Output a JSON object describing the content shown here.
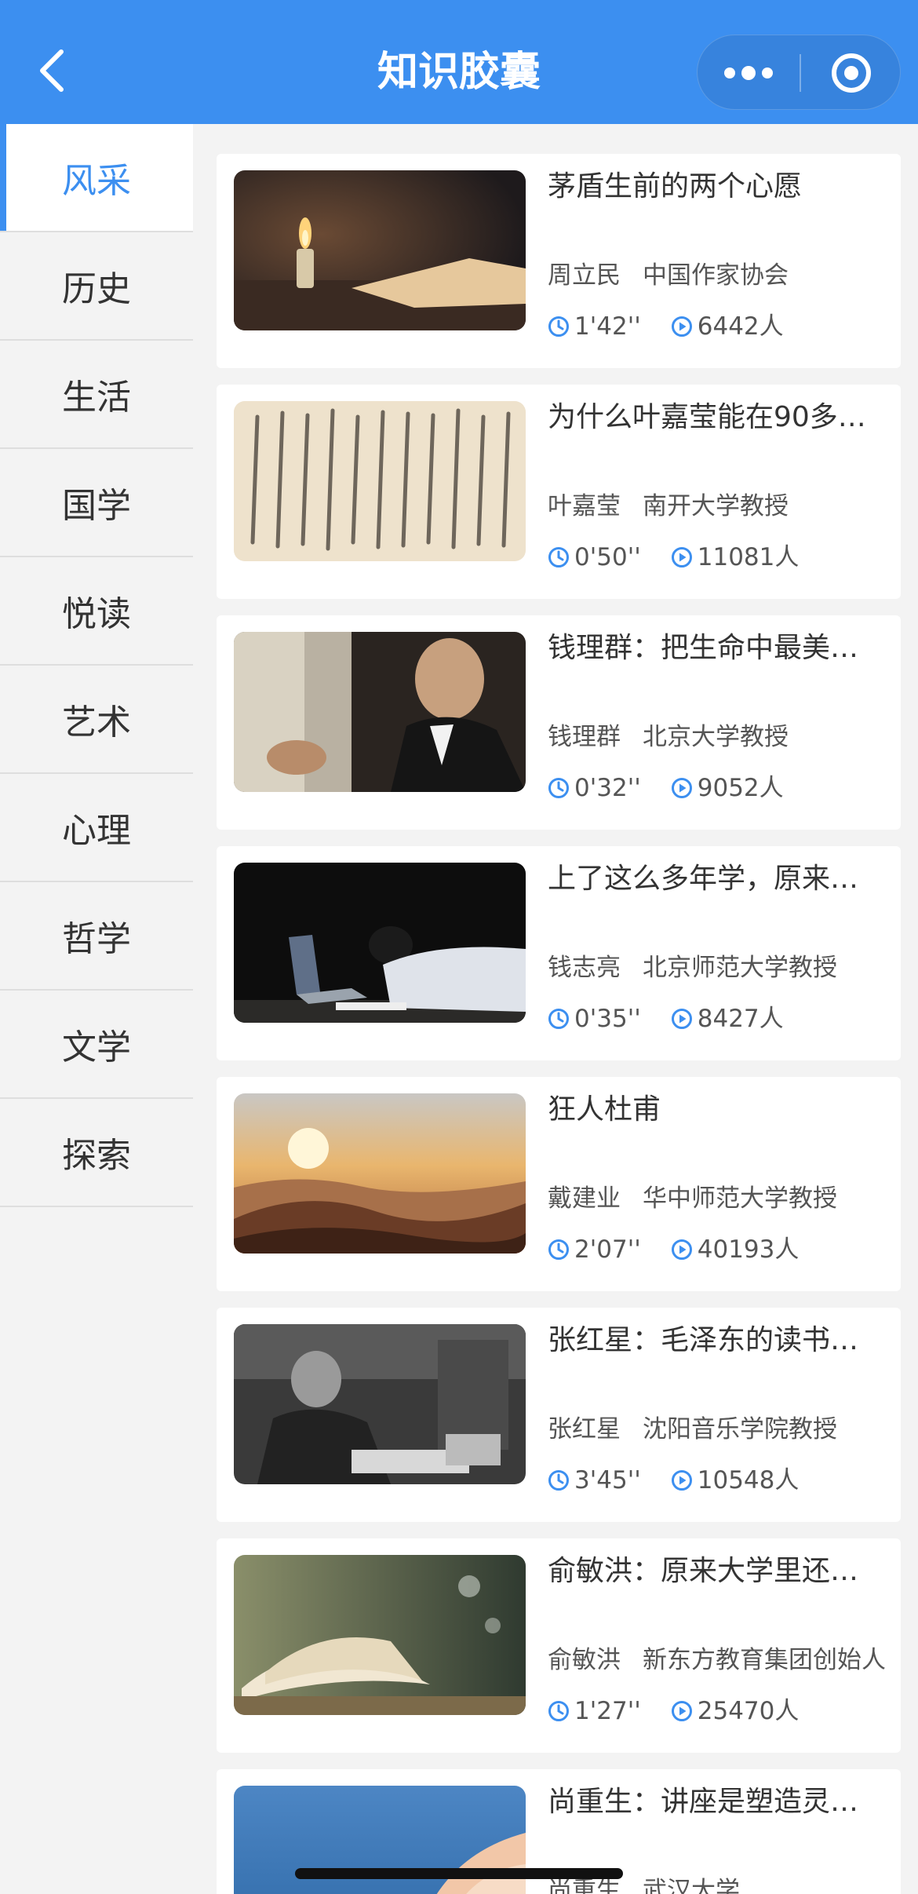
{
  "header": {
    "title": "知识胶囊",
    "back_icon": "chevron-left-icon",
    "more_icon": "more-dots-icon",
    "close_icon": "target-close-icon",
    "bg_color": "#3c8ff0"
  },
  "sidebar": {
    "active_index": 0,
    "items": [
      {
        "label": "风采"
      },
      {
        "label": "历史"
      },
      {
        "label": "生活"
      },
      {
        "label": "国学"
      },
      {
        "label": "悦读"
      },
      {
        "label": "艺术"
      },
      {
        "label": "心理"
      },
      {
        "label": "哲学"
      },
      {
        "label": "文学"
      },
      {
        "label": "探索"
      }
    ]
  },
  "cards": [
    {
      "title": "茅盾生前的两个心愿",
      "author": "周立民",
      "org": "中国作家协会",
      "duration": "1'42''",
      "views": "6442人",
      "thumb": "candle-image"
    },
    {
      "title": "为什么叶嘉莹能在90多…",
      "author": "叶嘉莹",
      "org": "南开大学教授",
      "duration": "0'50''",
      "views": "11081人",
      "thumb": "calligraphy-image"
    },
    {
      "title": "钱理群：把生命中最美…",
      "author": "钱理群",
      "org": "北京大学教授",
      "duration": "0'32''",
      "views": "9052人",
      "thumb": "portrait-image"
    },
    {
      "title": "上了这么多年学，原来…",
      "author": "钱志亮",
      "org": "北京师范大学教授",
      "duration": "0'35''",
      "views": "8427人",
      "thumb": "student-laptop-image"
    },
    {
      "title": "狂人杜甫",
      "author": "戴建业",
      "org": "华中师范大学教授",
      "duration": "2'07''",
      "views": "40193人",
      "thumb": "mountain-sunset-image"
    },
    {
      "title": "张红星：毛泽东的读书…",
      "author": "张红星",
      "org": "沈阳音乐学院教授",
      "duration": "3'45''",
      "views": "10548人",
      "thumb": "reading-photo-image"
    },
    {
      "title": "俞敏洪：原来大学里还…",
      "author": "俞敏洪",
      "org": "新东方教育集团创始人",
      "duration": "1'27''",
      "views": "25470人",
      "thumb": "open-book-image"
    },
    {
      "title": "尚重生：讲座是塑造灵…",
      "author": "尚重生",
      "org": "武汉大学",
      "duration": "",
      "views": "",
      "thumb": "blue-pages-image"
    }
  ]
}
